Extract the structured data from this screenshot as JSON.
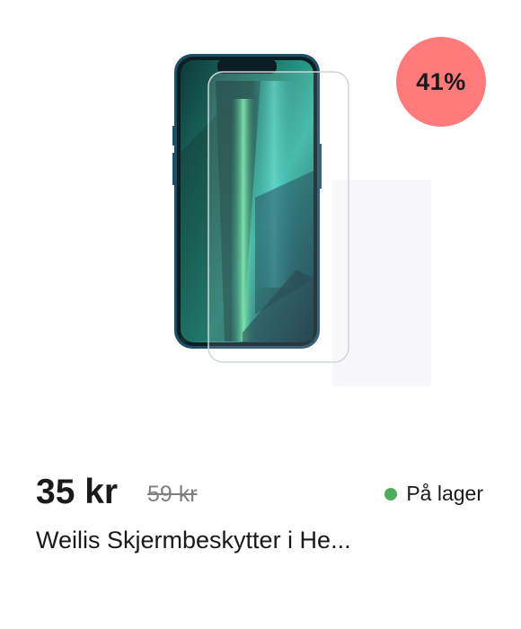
{
  "product": {
    "image_icon": "phone-screen-protector-image",
    "discount_badge": "41%",
    "price_current": "35 kr",
    "price_old": "59 kr",
    "stock_status": "På lager",
    "title": "Weilis Skjermbeskytter i He..."
  },
  "colors": {
    "badge": "#ff7b7b",
    "stock_dot": "#4cae5b",
    "old_price": "#808080"
  }
}
